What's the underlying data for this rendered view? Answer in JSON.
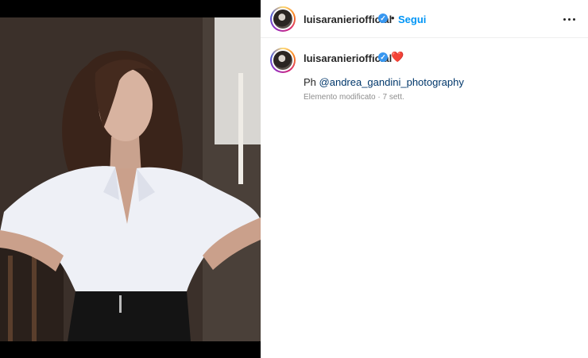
{
  "post": {
    "username": "luisaranieriofficial",
    "verified_badge": "✓",
    "separator": "•",
    "follow_label": "Segui",
    "more_icon": "more-horizontal-icon"
  },
  "caption": {
    "username": "luisaranieriofficial",
    "verified_badge": "✓",
    "emoji": "❤️",
    "prefix": "Ph",
    "mention": "@andrea_gandini_photography",
    "edited_label": "Elemento modificato",
    "meta_separator": "·",
    "time_ago": "7 sett."
  },
  "colors": {
    "accent": "#0095f6",
    "verified": "#3897f0",
    "mention": "#00376b",
    "muted": "#8e8e8e"
  }
}
